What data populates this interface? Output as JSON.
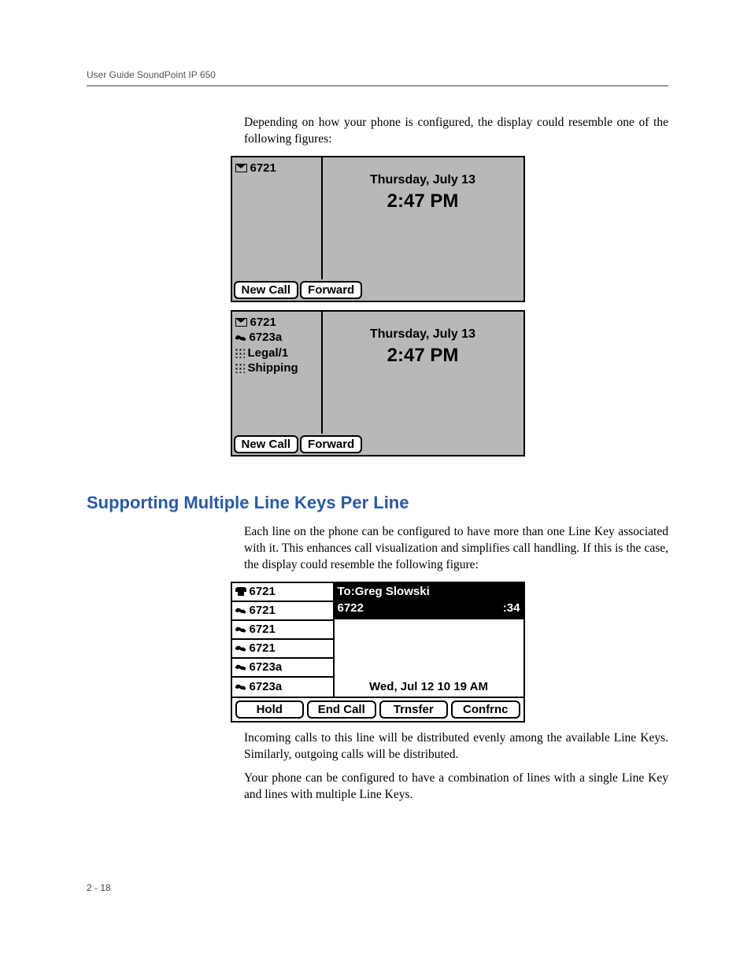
{
  "header": "User Guide SoundPoint IP 650",
  "intro_para": "Depending on how your phone is configured, the display could resemble one of the following figures:",
  "screen1": {
    "lines": [
      {
        "icon": "envelope",
        "label": "6721"
      }
    ],
    "date": "Thursday, July 13",
    "time": "2:47 PM",
    "softkeys": [
      "New Call",
      "Forward"
    ]
  },
  "screen2": {
    "lines": [
      {
        "icon": "envelope",
        "label": "6721"
      },
      {
        "icon": "phone",
        "label": "6723a"
      },
      {
        "icon": "grid",
        "label": "Legal/1"
      },
      {
        "icon": "grid",
        "label": "Shipping"
      }
    ],
    "date": "Thursday, July 13",
    "time": "2:47 PM",
    "softkeys": [
      "New Call",
      "Forward"
    ]
  },
  "section_heading": "Supporting Multiple Line Keys Per Line",
  "section_para": "Each line on the phone can be configured to have more than one Line Key associated with it. This enhances call visualization and simplifies call handling. If this is the case, the display could resemble the following figure:",
  "screen3": {
    "lines": [
      {
        "icon": "phone2",
        "label": "6721"
      },
      {
        "icon": "phone",
        "label": "6721"
      },
      {
        "icon": "phone",
        "label": "6721"
      },
      {
        "icon": "phone",
        "label": "6721"
      },
      {
        "icon": "phone",
        "label": "6723a"
      },
      {
        "icon": "phone",
        "label": "6723a"
      }
    ],
    "call_to": "To:Greg Slowski",
    "call_num": "6722",
    "call_time": ":34",
    "date": "Wed, Jul 12  10 19 AM",
    "softkeys": [
      "Hold",
      "End Call",
      "Trnsfer",
      "Confrnc"
    ]
  },
  "closing_para1": "Incoming calls to this line will be distributed evenly among the available Line Keys. Similarly, outgoing calls will be distributed.",
  "closing_para2": "Your phone can be configured to have a combination of lines with a single Line Key and lines with multiple Line Keys.",
  "page_num": "2 - 18"
}
